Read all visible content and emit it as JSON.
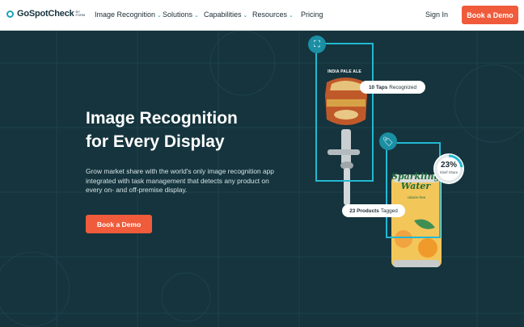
{
  "nav": {
    "brand": "GoSpotCheck",
    "brand_sub": "BY FORM",
    "items": [
      {
        "label": "Image Recognition",
        "chevron": true
      },
      {
        "label": "Solutions",
        "chevron": true
      },
      {
        "label": "Capabilities",
        "chevron": true
      },
      {
        "label": "Resources",
        "chevron": true
      },
      {
        "label": "Pricing",
        "chevron": false
      }
    ],
    "sign_in": "Sign In",
    "cta": "Book a Demo"
  },
  "hero": {
    "title_line1": "Image Recognition",
    "title_line2": "for Every Display",
    "body": "Grow market share with the world's only image recognition app integrated with task management that detects any product on every on- and off-premise display.",
    "cta": "Book a Demo"
  },
  "visual": {
    "tap_label": "INDIA PALE ALE",
    "taps_count": "10 Taps",
    "taps_status": "Recognized",
    "products_count": "23 Products",
    "products_status": "Tagged",
    "shelf_pct": "23%",
    "shelf_label": "Shelf Share",
    "can_line1": "Sparkling",
    "can_line2": "Water",
    "can_sub": "calorie-free",
    "icons": [
      "expand-icon",
      "tag-icon"
    ]
  },
  "colors": {
    "accent": "#ef5b3b",
    "teal": "#22b8d2",
    "hero_bg": "#15343d"
  }
}
